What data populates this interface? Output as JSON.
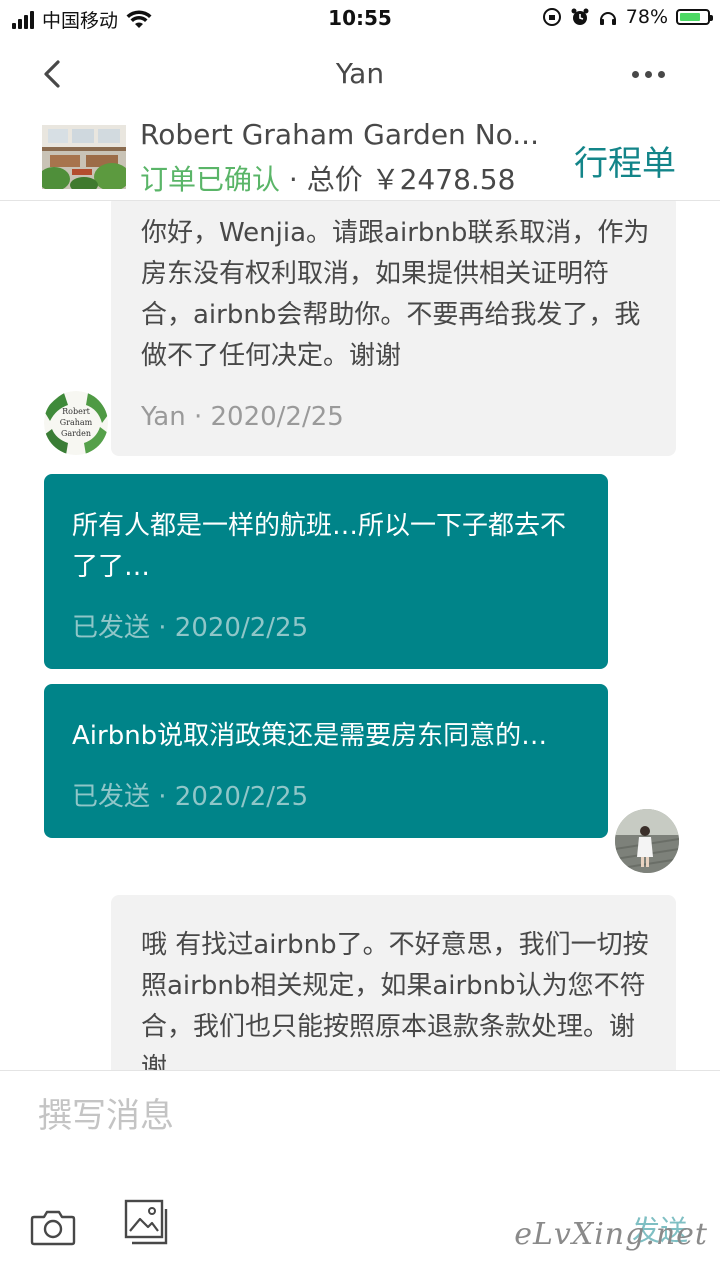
{
  "status_bar": {
    "carrier": "中国移动",
    "time": "10:55",
    "battery_percent": "78%",
    "battery_level": 0.78
  },
  "nav": {
    "title": "Yan"
  },
  "listing": {
    "title": "Robert Graham Garden No...",
    "status": "订单已确认",
    "separator": " · ",
    "price_text": "总价 ￥2478.58",
    "itinerary_label": "行程单"
  },
  "messages": [
    {
      "direction": "in",
      "text": "你好，Wenjia。请跟airbnb联系取消，作为房东没有权利取消，如果提供相关证明符合，airbnb会帮助你。不要再给我发了，我做不了任何决定。谢谢",
      "meta": "Yan · 2020/2/25"
    },
    {
      "direction": "out",
      "text": "所有人都是一样的航班…所以一下子都去不了了…",
      "meta": "已发送 · 2020/2/25"
    },
    {
      "direction": "out",
      "text": "Airbnb说取消政策还是需要房东同意的…",
      "meta": "已发送 · 2020/2/25"
    },
    {
      "direction": "in",
      "text": "哦 有找过airbnb了。不好意思，我们一切按照airbnb相关规定，如果airbnb认为您不符合，我们也只能按照原本退款条款处理。谢谢",
      "meta": ""
    }
  ],
  "host_avatar_text": [
    "Robert",
    "Graham",
    "Garden"
  ],
  "composer": {
    "placeholder": "撰写消息",
    "send_label": "发送"
  },
  "watermark": "eLvXing.net",
  "colors": {
    "accent": "#008489",
    "confirmed_green": "#5ab568",
    "itinerary_teal": "#138589",
    "incoming_bubble": "#f2f2f2"
  }
}
